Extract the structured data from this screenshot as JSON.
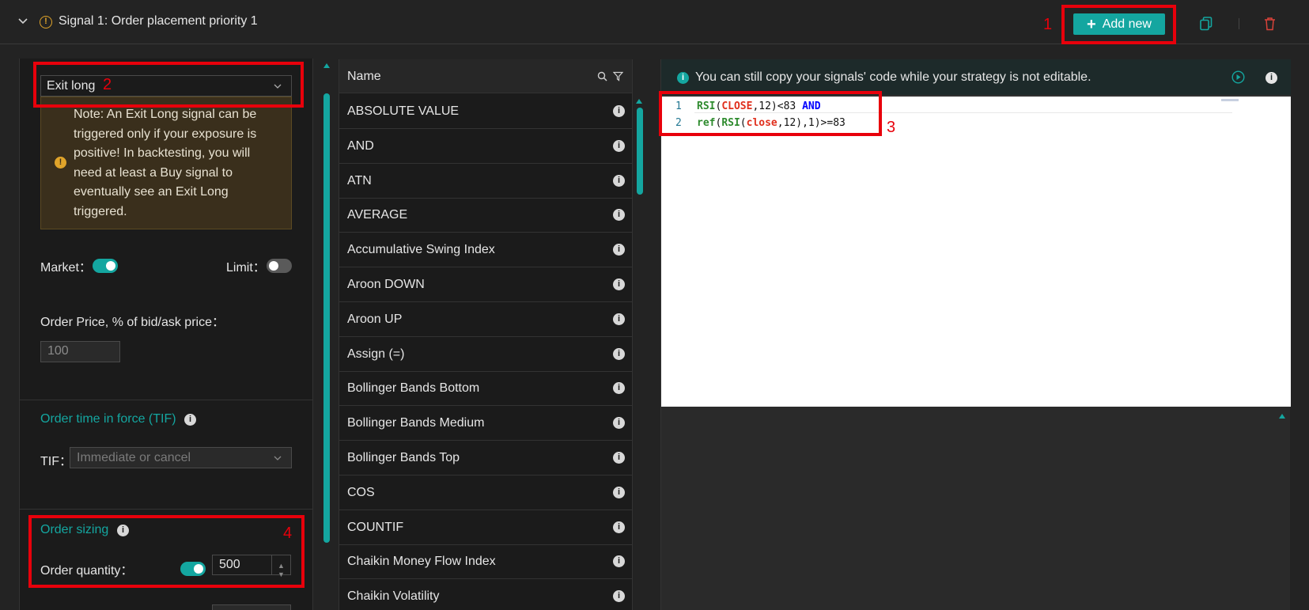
{
  "header": {
    "title": "Signal 1: Order placement priority 1",
    "add_button_label": "Add new"
  },
  "left": {
    "signal_type": "Exit long",
    "note": "Note: An Exit Long signal can be triggered only if your exposure is positive! In backtesting, you will need at least a Buy signal to eventually see an Exit Long triggered.",
    "market_label": "Market：",
    "market_on": true,
    "limit_label": "Limit：",
    "limit_on": false,
    "order_price_label": "Order Price, % of bid/ask price：",
    "order_price_value": "100",
    "tif_section_title": "Order time in force (TIF)",
    "tif_label": "TIF：",
    "tif_value": "Immediate or cancel",
    "sizing_title": "Order sizing",
    "quantity_label": "Order quantity：",
    "quantity_on": true,
    "quantity_value": "500"
  },
  "function_list": {
    "header": "Name",
    "items": [
      "ABSOLUTE VALUE",
      "AND",
      "ATN",
      "AVERAGE",
      "Accumulative Swing Index",
      "Aroon DOWN",
      "Aroon UP",
      "Assign (=)",
      "Bollinger Bands Bottom",
      "Bollinger Bands Medium",
      "Bollinger Bands Top",
      "COS",
      "COUNTIF",
      "Chaikin Money Flow Index",
      "Chaikin Volatility"
    ]
  },
  "editor": {
    "banner": "You can still copy your signals' code while your strategy is not editable.",
    "lines": [
      {
        "number": "1",
        "tokens": [
          {
            "text": "RSI",
            "kind": "fn"
          },
          {
            "text": "(",
            "kind": "num"
          },
          {
            "text": "CLOSE",
            "kind": "var"
          },
          {
            "text": ",12)<83 ",
            "kind": "num"
          },
          {
            "text": "AND",
            "kind": "op"
          }
        ]
      },
      {
        "number": "2",
        "tokens": [
          {
            "text": "ref",
            "kind": "fn"
          },
          {
            "text": "(",
            "kind": "num"
          },
          {
            "text": "RSI",
            "kind": "fn"
          },
          {
            "text": "(",
            "kind": "num"
          },
          {
            "text": "close",
            "kind": "var"
          },
          {
            "text": ",12),1)>=83",
            "kind": "num"
          }
        ]
      }
    ]
  },
  "annotations": [
    "1",
    "2",
    "3",
    "4"
  ],
  "colors": {
    "accent": "#14a6a0",
    "warning": "#e0a42a",
    "annotation": "#e8000b",
    "delete": "#d9433a"
  }
}
